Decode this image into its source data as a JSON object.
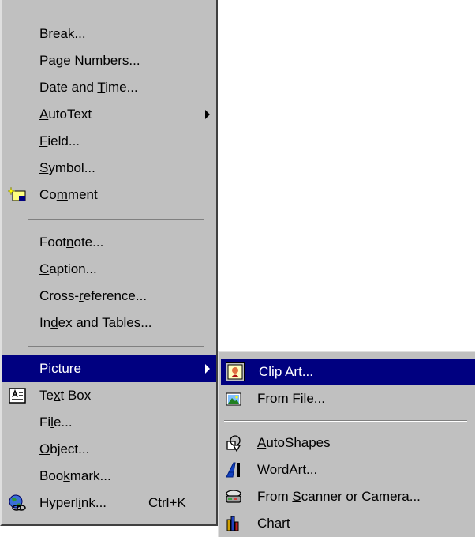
{
  "main_menu": {
    "items": [
      {
        "before": "",
        "key": "B",
        "after": "reak..."
      },
      {
        "before": "Page N",
        "key": "u",
        "after": "mbers..."
      },
      {
        "before": "Date and ",
        "key": "T",
        "after": "ime..."
      },
      {
        "before": "",
        "key": "A",
        "after": "utoText"
      },
      {
        "before": "",
        "key": "F",
        "after": "ield..."
      },
      {
        "before": "",
        "key": "S",
        "after": "ymbol..."
      },
      {
        "before": "Co",
        "key": "m",
        "after": "ment"
      },
      {
        "before": "Foot",
        "key": "n",
        "after": "ote..."
      },
      {
        "before": "",
        "key": "C",
        "after": "aption..."
      },
      {
        "before": "Cross-",
        "key": "r",
        "after": "eference..."
      },
      {
        "before": "In",
        "key": "d",
        "after": "ex and Tables..."
      },
      {
        "before": "",
        "key": "P",
        "after": "icture"
      },
      {
        "before": "Te",
        "key": "x",
        "after": "t Box"
      },
      {
        "before": "Fi",
        "key": "l",
        "after": "e..."
      },
      {
        "before": "",
        "key": "O",
        "after": "bject..."
      },
      {
        "before": "Boo",
        "key": "k",
        "after": "mark..."
      },
      {
        "before": "Hyperl",
        "key": "i",
        "after": "nk...",
        "shortcut": "Ctrl+K"
      }
    ]
  },
  "sub_menu": {
    "items": [
      {
        "before": "",
        "key": "C",
        "after": "lip Art..."
      },
      {
        "before": "",
        "key": "F",
        "after": "rom File..."
      },
      {
        "before": "",
        "key": "A",
        "after": "utoShapes"
      },
      {
        "before": "",
        "key": "W",
        "after": "ordArt..."
      },
      {
        "before": "From ",
        "key": "S",
        "after": "canner or Camera..."
      },
      {
        "before": "Chart",
        "key": "",
        "after": ""
      }
    ]
  },
  "icons": [
    "comment-icon",
    "textbox-icon",
    "hyperlink-globe-icon",
    "clipart-icon",
    "from-file-icon",
    "autoshapes-icon",
    "wordart-icon",
    "scanner-camera-icon",
    "chart-icon"
  ],
  "colors": {
    "menu_bg": "#c0c0c0",
    "highlight": "#000080",
    "highlight_text": "#ffffff"
  }
}
